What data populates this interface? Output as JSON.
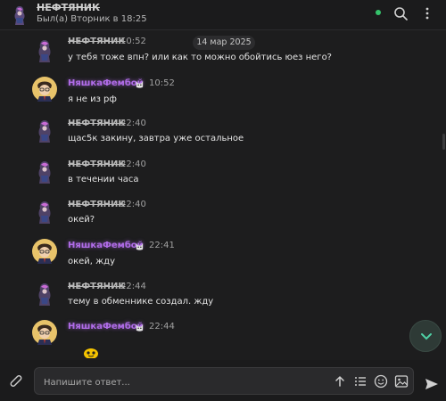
{
  "header": {
    "title": "НЕФТЯНИК",
    "status": "Был(а) Вторник в 18:25",
    "online_color": "#35c36b",
    "icons": [
      "search-icon",
      "more-vertical-icon"
    ]
  },
  "date_separator": "14 мар 2025",
  "messages": [
    {
      "author": "НЕФТЯНИК",
      "time": "10:52",
      "text": "у тебя тоже впн? или как то можно обойтись юез него?"
    },
    {
      "author": "НяшкаФембой",
      "time": "10:52",
      "text": "я не из рф"
    },
    {
      "author": "НЕФТЯНИК",
      "time": "22:40",
      "text": "щас5к закину, завтра уже остальное"
    },
    {
      "author": "НЕФТЯНИК",
      "time": "22:40",
      "text": "в течении часа"
    },
    {
      "author": "НЕФТЯНИК",
      "time": "22:40",
      "text": "окей?"
    },
    {
      "author": "НяшкаФембой",
      "time": "22:41",
      "text": "окей, жду"
    },
    {
      "author": "НЕФТЯНИК",
      "time": "22:44",
      "text": "тему в обменнике создал. жду"
    },
    {
      "author": "НяшкаФембой",
      "time": "22:44",
      "text": ""
    }
  ],
  "composer": {
    "placeholder": "Напишите ответ...",
    "tools": [
      "arrow-up-icon",
      "list-icon",
      "emoji-icon",
      "image-icon"
    ]
  },
  "colors": {
    "accent_name": "#b06ce8",
    "background": "#1d1d1e",
    "scroll_button": "#4fd1a5"
  }
}
